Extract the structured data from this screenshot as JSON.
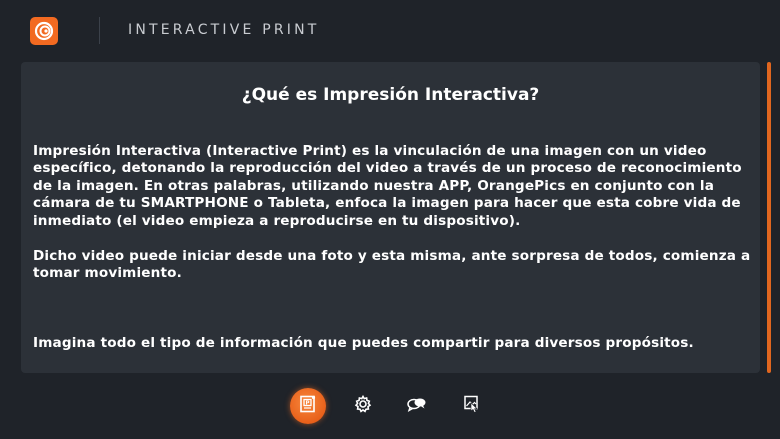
{
  "header": {
    "title": "INTERACTIVE PRINT",
    "logo_icon": "orangepics-logo-icon"
  },
  "content": {
    "title": "¿Qué es Impresión Interactiva?",
    "paragraph1": "Impresión Interactiva (Interactive Print) es la vinculación de una imagen con un video específico, detonando la reproducción del video a través de un proceso de reconocimiento de la imagen. En otras palabras, utilizando nuestra APP, OrangePics en conjunto con la cámara de tu SMARTPHONE o Tableta, enfoca la imagen para hacer que esta cobre vida de inmediato (el video empieza a reproducirse en tu dispositivo).",
    "paragraph2": " Dicho video puede iniciar desde una foto y esta misma, ante sorpresa de todos, comienza a tomar movimiento.",
    "paragraph3": "Imagina todo el tipo de información que puedes compartir para diversos propósitos."
  },
  "nav": {
    "items": [
      {
        "icon": "interactive-print-icon",
        "active": true
      },
      {
        "icon": "settings-gear-icon",
        "active": false
      },
      {
        "icon": "chat-bubbles-icon",
        "active": false
      },
      {
        "icon": "touch-image-icon",
        "active": false
      }
    ]
  },
  "colors": {
    "accent": "#f26a21",
    "background": "#1f2329",
    "card": "#2c3138"
  }
}
